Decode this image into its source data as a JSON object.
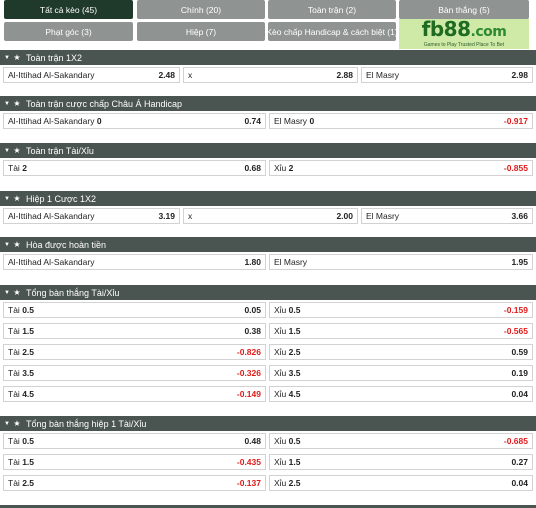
{
  "tabs": [
    {
      "label": "Tất cả kèo (45)",
      "active": true
    },
    {
      "label": "Chính (20)"
    },
    {
      "label": "Toàn trận (2)"
    },
    {
      "label": "Bàn thắng (5)"
    },
    {
      "label": "Phạt góc (3)"
    },
    {
      "label": "Hiệp (7)"
    },
    {
      "label": "Kèo chấp Handicap & cách biệt (1)"
    }
  ],
  "logo": {
    "main": "fb88",
    "suffix": ".com",
    "tagline": "Games to Play   Trusted Place To Bet"
  },
  "sections": [
    {
      "title": "Toàn trận 1X2",
      "rows": [
        [
          {
            "label": "Al-Ittihad Al-Sakandary",
            "odd": "2.48"
          },
          {
            "label": "x",
            "odd": "2.88"
          },
          {
            "label": "El Masry",
            "odd": "2.98"
          }
        ]
      ]
    },
    {
      "title": "Toàn trận cược chấp Châu Á Handicap",
      "rows": [
        [
          {
            "label": "Al-Ittihad Al-Sakandary",
            "line": "0",
            "odd": "0.74"
          },
          {
            "label": "El Masry",
            "line": "0",
            "odd": "-0.917"
          }
        ]
      ]
    },
    {
      "title": "Toàn trận Tài/Xỉu",
      "rows": [
        [
          {
            "label": "Tài",
            "line": "2",
            "odd": "0.68"
          },
          {
            "label": "Xỉu",
            "line": "2",
            "odd": "-0.855"
          }
        ]
      ]
    },
    {
      "title": "Hiệp 1 Cược 1X2",
      "rows": [
        [
          {
            "label": "Al-Ittihad Al-Sakandary",
            "odd": "3.19"
          },
          {
            "label": "x",
            "odd": "2.00"
          },
          {
            "label": "El Masry",
            "odd": "3.66"
          }
        ]
      ]
    },
    {
      "title": "Hòa được hoàn tiền",
      "rows": [
        [
          {
            "label": "Al-Ittihad Al-Sakandary",
            "odd": "1.80"
          },
          {
            "label": "El Masry",
            "odd": "1.95"
          }
        ]
      ]
    },
    {
      "title": "Tổng bàn thắng Tài/Xỉu",
      "rows": [
        [
          {
            "label": "Tài",
            "line": "0.5",
            "odd": "0.05"
          },
          {
            "label": "Xỉu",
            "line": "0.5",
            "odd": "-0.159"
          }
        ],
        [
          {
            "label": "Tài",
            "line": "1.5",
            "odd": "0.38"
          },
          {
            "label": "Xỉu",
            "line": "1.5",
            "odd": "-0.565"
          }
        ],
        [
          {
            "label": "Tài",
            "line": "2.5",
            "odd": "-0.826"
          },
          {
            "label": "Xỉu",
            "line": "2.5",
            "odd": "0.59"
          }
        ],
        [
          {
            "label": "Tài",
            "line": "3.5",
            "odd": "-0.326"
          },
          {
            "label": "Xỉu",
            "line": "3.5",
            "odd": "0.19"
          }
        ],
        [
          {
            "label": "Tài",
            "line": "4.5",
            "odd": "-0.149"
          },
          {
            "label": "Xỉu",
            "line": "4.5",
            "odd": "0.04"
          }
        ]
      ]
    },
    {
      "title": "Tổng bàn thắng hiệp 1 Tài/Xỉu",
      "rows": [
        [
          {
            "label": "Tài",
            "line": "0.5",
            "odd": "0.48"
          },
          {
            "label": "Xỉu",
            "line": "0.5",
            "odd": "-0.685"
          }
        ],
        [
          {
            "label": "Tài",
            "line": "1.5",
            "odd": "-0.435"
          },
          {
            "label": "Xỉu",
            "line": "1.5",
            "odd": "0.27"
          }
        ],
        [
          {
            "label": "Tài",
            "line": "2.5",
            "odd": "-0.137"
          },
          {
            "label": "Xỉu",
            "line": "2.5",
            "odd": "0.04"
          }
        ]
      ]
    }
  ],
  "colors": {
    "header_bg": "#4a5450",
    "tab_active": "#1f3a2b",
    "tab_bg": "#8f9492",
    "negative_odd": "#e01b1b",
    "logo_bg": "#cfe9a7"
  }
}
